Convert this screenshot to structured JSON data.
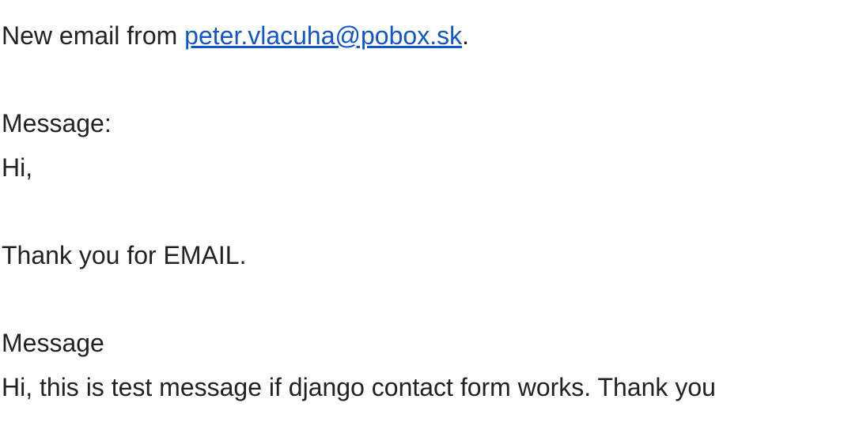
{
  "email": {
    "intro_prefix": "New email from ",
    "sender": "peter.vlacuha@pobox.sk",
    "intro_suffix": ".",
    "message_label": "Message:",
    "greeting": "Hi,",
    "thanks": "Thank you for EMAIL.",
    "message_heading": "Message",
    "message_body": "Hi, this is test message if django contact form works. Thank you"
  },
  "colors": {
    "text": "#222222",
    "link": "#1155cc"
  }
}
